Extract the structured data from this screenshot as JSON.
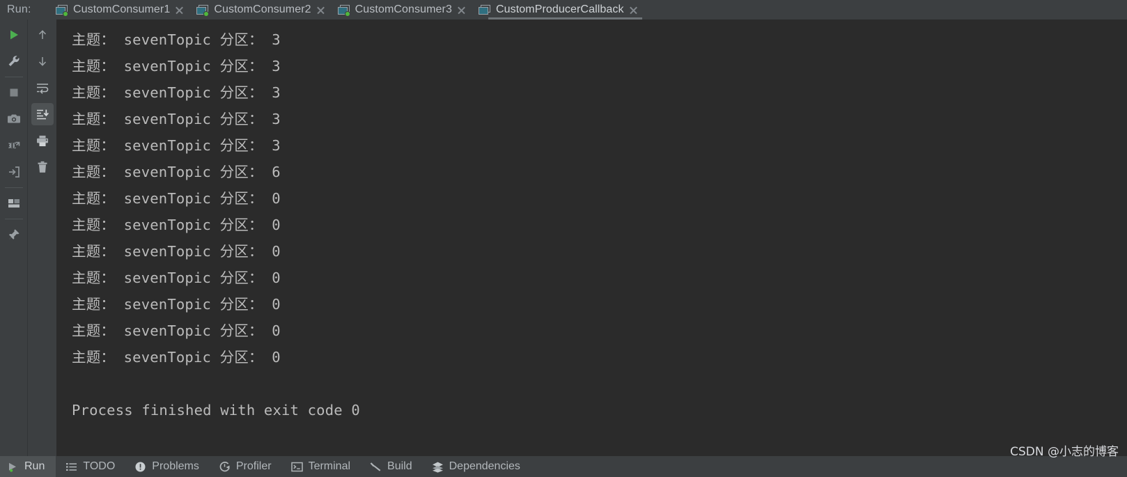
{
  "window": {
    "run_label": "Run:",
    "colors": {
      "chrome": "#3c3f41",
      "console_bg": "#2b2b2b",
      "console_text": "#bbbbbb",
      "accent_green": "#50b83c",
      "tab_underline": "#6d7377",
      "selected_bg": "#4e5254"
    }
  },
  "tabs": [
    {
      "label": "CustomConsumer1",
      "icon": "console-window-icon",
      "running": true,
      "active": false,
      "close_icon": "close-icon"
    },
    {
      "label": "CustomConsumer2",
      "icon": "console-window-icon",
      "running": true,
      "active": false,
      "close_icon": "close-icon"
    },
    {
      "label": "CustomConsumer3",
      "icon": "console-window-icon",
      "running": true,
      "active": false,
      "close_icon": "close-icon"
    },
    {
      "label": "CustomProducerCallback",
      "icon": "console-window-icon",
      "running": false,
      "active": true,
      "close_icon": "close-icon"
    }
  ],
  "left_rail_primary": [
    {
      "name": "rerun-button",
      "icon": "play-icon"
    },
    {
      "name": "edit-configuration-button",
      "icon": "wrench-icon"
    },
    {
      "name": "separator-1",
      "icon": "separator"
    },
    {
      "name": "stop-button",
      "icon": "stop-square-icon"
    },
    {
      "name": "screenshot-button",
      "icon": "camera-icon"
    },
    {
      "name": "dump-threads-button",
      "icon": "thread-dump-icon"
    },
    {
      "name": "attach-process-button",
      "icon": "arrow-into-box-icon"
    },
    {
      "name": "separator-2",
      "icon": "separator"
    },
    {
      "name": "layout-button",
      "icon": "layout-icon"
    },
    {
      "name": "separator-3",
      "icon": "separator"
    },
    {
      "name": "pin-tab-button",
      "icon": "pin-icon"
    }
  ],
  "left_rail_secondary": [
    {
      "name": "previous-occurrence-button",
      "icon": "arrow-up-icon",
      "selected": false
    },
    {
      "name": "next-occurrence-button",
      "icon": "arrow-down-icon",
      "selected": false
    },
    {
      "name": "soft-wrap-button",
      "icon": "soft-wrap-icon",
      "selected": false
    },
    {
      "name": "scroll-to-end-button",
      "icon": "scroll-to-end-icon",
      "selected": true
    },
    {
      "name": "print-button",
      "icon": "printer-icon",
      "selected": false
    },
    {
      "name": "clear-all-button",
      "icon": "trash-icon",
      "selected": false
    }
  ],
  "console": {
    "lines": [
      "主题： sevenTopic 分区： 3",
      "主题： sevenTopic 分区： 3",
      "主题： sevenTopic 分区： 3",
      "主题： sevenTopic 分区： 3",
      "主题： sevenTopic 分区： 3",
      "主题： sevenTopic 分区： 6",
      "主题： sevenTopic 分区： 0",
      "主题： sevenTopic 分区： 0",
      "主题： sevenTopic 分区： 0",
      "主题： sevenTopic 分区： 0",
      "主题： sevenTopic 分区： 0",
      "主题： sevenTopic 分区： 0",
      "主题： sevenTopic 分区： 0"
    ],
    "blank_lines_after": 1,
    "exit_message": "Process finished with exit code 0"
  },
  "watermark": "CSDN @小志的博客",
  "status_bar": [
    {
      "label": "Run",
      "icon": "play-run-icon",
      "active": true
    },
    {
      "label": "TODO",
      "icon": "todo-list-icon",
      "active": false
    },
    {
      "label": "Problems",
      "icon": "problems-exclamation-icon",
      "active": false
    },
    {
      "label": "Profiler",
      "icon": "profiler-icon",
      "active": false
    },
    {
      "label": "Terminal",
      "icon": "terminal-icon",
      "active": false
    },
    {
      "label": "Build",
      "icon": "hammer-icon",
      "active": false
    },
    {
      "label": "Dependencies",
      "icon": "dependencies-layers-icon",
      "active": false
    }
  ]
}
